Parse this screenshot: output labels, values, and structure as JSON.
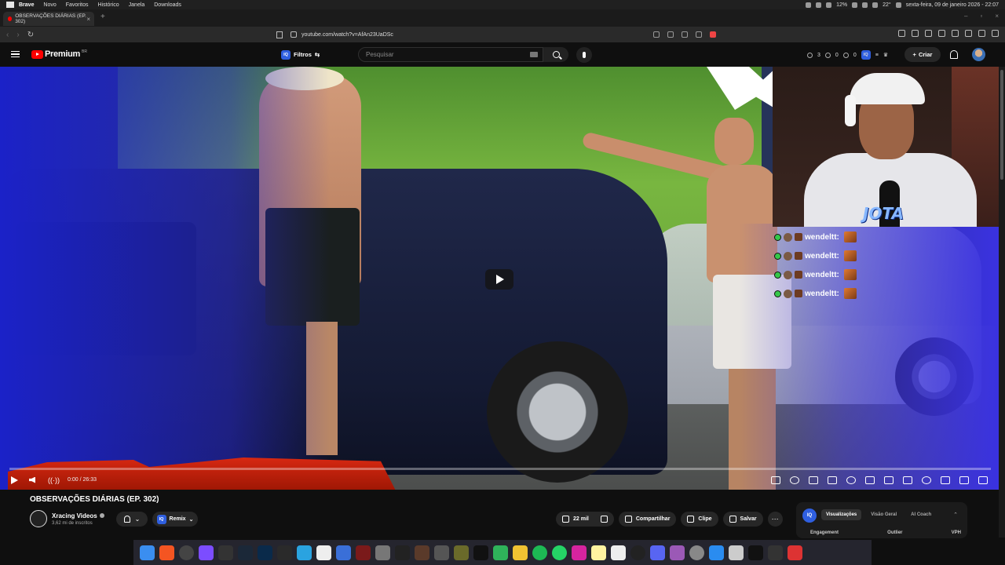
{
  "system": {
    "app": "Brave",
    "menus": [
      "Brave",
      "Novo",
      "Favoritos",
      "Histórico",
      "Janela",
      "Downloads"
    ],
    "battery": "12%",
    "temperature": "22°",
    "datetime": "sexta-feira, 09 de janeiro 2026 - 22:07"
  },
  "browser": {
    "tab_title": "OBSERVAÇÕES DIÁRIAS (EP. 302)",
    "url": "youtube.com/watch?v=AfAn23UaDSc"
  },
  "youtube": {
    "brand": "Premium",
    "brand_region": "BR",
    "filters_label": "Filtros",
    "search_placeholder": "Pesquisar",
    "header_stats": [
      "3",
      "0",
      "0"
    ],
    "create_label": "Criar"
  },
  "player": {
    "current_time": "0:00",
    "duration": "26:33",
    "progress": 0,
    "time_display": "0:00 / 26:33"
  },
  "stream_overlay": {
    "cam_logo": "JOTA",
    "chat": [
      {
        "user": "wendeltt:"
      },
      {
        "user": "wendeltt:"
      },
      {
        "user": "wendeltt:"
      },
      {
        "user": "wendeltt:"
      }
    ]
  },
  "video_info": {
    "title": "OBSERVAÇÕES DIÁRIAS (EP. 302)",
    "channel": "Xracing Videos",
    "subscribers": "3,62 mi de inscritos",
    "remix": "Remix",
    "likes": "22 mil",
    "share": "Compartilhar",
    "clip": "Clipe",
    "save": "Salvar"
  },
  "analytics_panel": {
    "badge": "IQ",
    "tabs": [
      "Visualizações",
      "Visão Geral",
      "AI Coach"
    ],
    "columns": [
      "Engagement",
      "Outlier",
      "VPH"
    ]
  },
  "colors": {
    "youtube_red": "#ff0000",
    "iq_blue": "#2f5fe0",
    "background": "#0f0f0f"
  },
  "dock_icons": [
    "finder-icon",
    "brave-icon",
    "chrome-icon",
    "obsidian-icon",
    "github-icon",
    "steam-icon",
    "photoshop-icon",
    "davinci-icon",
    "telegram-icon",
    "notion-icon",
    "todo-icon",
    "game1-icon",
    "game2-icon",
    "game3-icon",
    "game4-icon",
    "game5-icon",
    "game6-icon",
    "game7-icon",
    "drive-icon",
    "folder-icon",
    "spotify-icon",
    "whatsapp-icon",
    "instagram-icon",
    "notes-icon",
    "help-icon",
    "chatgpt-icon",
    "discord-icon",
    "xbox-icon",
    "settings-icon",
    "app-store-icon",
    "preview-icon",
    "terminal-icon",
    "monitor-icon",
    "trash-icon"
  ]
}
